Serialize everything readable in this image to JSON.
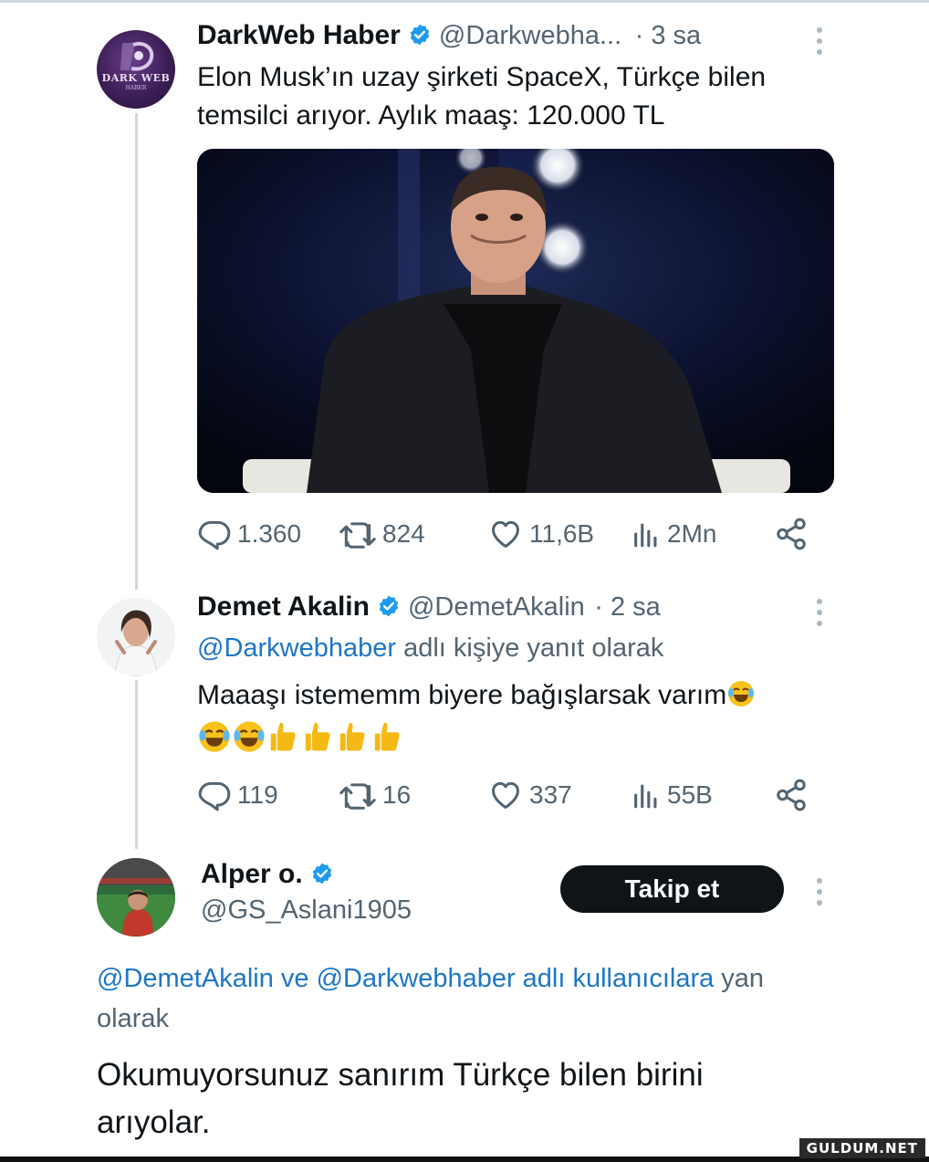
{
  "tweet1": {
    "name": "DarkWeb Haber",
    "handle": "@Darkwebha...",
    "time": "· 3 sa",
    "text_line1": "Elon Musk’ın uzay şirketi SpaceX, Türkçe bilen",
    "text_line2": "temsilci arıyor. Aylık maaş: 120.000 TL",
    "avatar_logo_text": "DARK WEB",
    "avatar_logo_sub": "HABER",
    "stats": {
      "replies": "1.360",
      "retweets": "824",
      "likes": "11,6B",
      "views": "2Mn"
    }
  },
  "tweet2": {
    "name": "Demet Akalin",
    "handle": "@DemetAkalin",
    "time": "· 2 sa",
    "reply_to_handle": "@Darkwebhaber",
    "reply_to_suffix": "adlı kişiye yanıt olarak",
    "text_line1": "Maaaşı istememm biyere bağışlarsak varım",
    "stats": {
      "replies": "119",
      "retweets": "16",
      "likes": "337",
      "views": "55B"
    }
  },
  "tweet3": {
    "name": "Alper o.",
    "handle": "@GS_Aslani1905",
    "follow_label": "Takip et",
    "reply_to_link": "@DemetAkalin ve @Darkwebhaber adlı kullanıcılara",
    "reply_to_suffix": " yan",
    "reply_to_line2": "olarak",
    "text_line1": "Okumuyorsunuz sanırım Türkçe bilen birini",
    "text_line2": "arıyolar."
  },
  "watermark": "GULDUM.NET",
  "icons": [
    "verified-badge-icon",
    "more-icon",
    "reply-icon",
    "retweet-icon",
    "like-icon",
    "views-icon",
    "share-icon",
    "laughing-emoji-icon",
    "thumbs-up-emoji-icon"
  ],
  "colors": {
    "link": "#1d76c8",
    "verified": "#1d9bf0",
    "muted": "#536471",
    "button": "#0f1419"
  }
}
